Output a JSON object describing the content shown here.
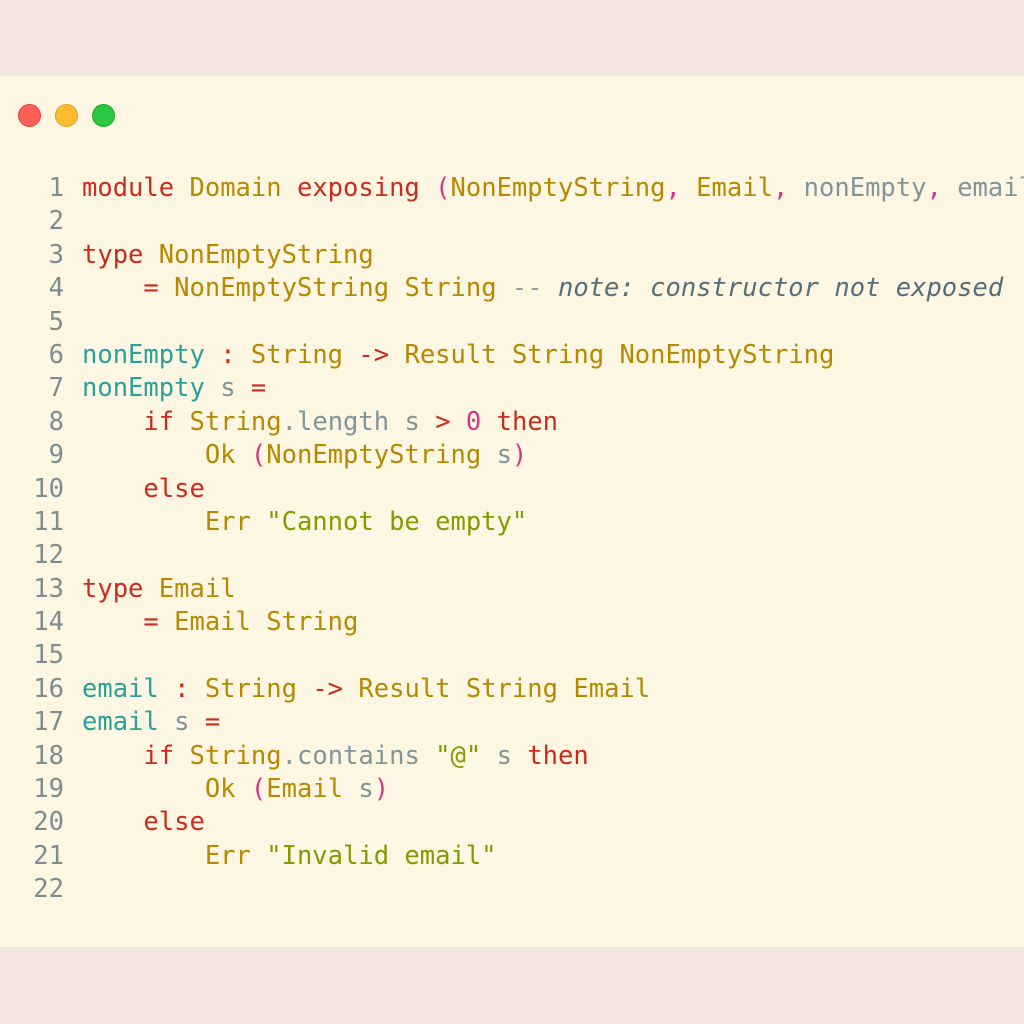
{
  "window": {
    "controls": [
      "close",
      "minimize",
      "zoom"
    ]
  },
  "editor": {
    "lines": [
      [
        [
          "kw",
          "module"
        ],
        [
          "plain",
          " "
        ],
        [
          "ty",
          "Domain"
        ],
        [
          "plain",
          " "
        ],
        [
          "kw",
          "exposing"
        ],
        [
          "plain",
          " "
        ],
        [
          "pn",
          "("
        ],
        [
          "ty",
          "NonEmptyString"
        ],
        [
          "pn",
          ","
        ],
        [
          "plain",
          " "
        ],
        [
          "ty",
          "Email"
        ],
        [
          "pn",
          ","
        ],
        [
          "plain",
          " "
        ],
        [
          "var",
          "nonEmpty"
        ],
        [
          "pn",
          ","
        ],
        [
          "plain",
          " "
        ],
        [
          "var",
          "email"
        ],
        [
          "pn",
          ")"
        ]
      ],
      [],
      [
        [
          "kw",
          "type"
        ],
        [
          "plain",
          " "
        ],
        [
          "ty",
          "NonEmptyString"
        ]
      ],
      [
        [
          "plain",
          "    "
        ],
        [
          "op",
          "="
        ],
        [
          "plain",
          " "
        ],
        [
          "ty",
          "NonEmptyString"
        ],
        [
          "plain",
          " "
        ],
        [
          "ty",
          "String"
        ],
        [
          "plain",
          " "
        ],
        [
          "cmd",
          "--"
        ],
        [
          "plain",
          " "
        ],
        [
          "cm",
          "note: constructor not exposed"
        ]
      ],
      [],
      [
        [
          "fn",
          "nonEmpty"
        ],
        [
          "plain",
          " "
        ],
        [
          "op",
          ":"
        ],
        [
          "plain",
          " "
        ],
        [
          "ty",
          "String"
        ],
        [
          "plain",
          " "
        ],
        [
          "op",
          "->"
        ],
        [
          "plain",
          " "
        ],
        [
          "ty",
          "Result"
        ],
        [
          "plain",
          " "
        ],
        [
          "ty",
          "String"
        ],
        [
          "plain",
          " "
        ],
        [
          "ty",
          "NonEmptyString"
        ]
      ],
      [
        [
          "fn",
          "nonEmpty"
        ],
        [
          "plain",
          " "
        ],
        [
          "var",
          "s"
        ],
        [
          "plain",
          " "
        ],
        [
          "op",
          "="
        ]
      ],
      [
        [
          "plain",
          "    "
        ],
        [
          "kw",
          "if"
        ],
        [
          "plain",
          " "
        ],
        [
          "ty",
          "String"
        ],
        [
          "var",
          "."
        ],
        [
          "var",
          "length"
        ],
        [
          "plain",
          " "
        ],
        [
          "var",
          "s"
        ],
        [
          "plain",
          " "
        ],
        [
          "op",
          ">"
        ],
        [
          "plain",
          " "
        ],
        [
          "num",
          "0"
        ],
        [
          "plain",
          " "
        ],
        [
          "kw",
          "then"
        ]
      ],
      [
        [
          "plain",
          "        "
        ],
        [
          "ty",
          "Ok"
        ],
        [
          "plain",
          " "
        ],
        [
          "pn",
          "("
        ],
        [
          "ty",
          "NonEmptyString"
        ],
        [
          "plain",
          " "
        ],
        [
          "var",
          "s"
        ],
        [
          "pn",
          ")"
        ]
      ],
      [
        [
          "plain",
          "    "
        ],
        [
          "kw",
          "else"
        ]
      ],
      [
        [
          "plain",
          "        "
        ],
        [
          "ty",
          "Err"
        ],
        [
          "plain",
          " "
        ],
        [
          "str",
          "\"Cannot be empty\""
        ]
      ],
      [],
      [
        [
          "kw",
          "type"
        ],
        [
          "plain",
          " "
        ],
        [
          "ty",
          "Email"
        ]
      ],
      [
        [
          "plain",
          "    "
        ],
        [
          "op",
          "="
        ],
        [
          "plain",
          " "
        ],
        [
          "ty",
          "Email"
        ],
        [
          "plain",
          " "
        ],
        [
          "ty",
          "String"
        ]
      ],
      [],
      [
        [
          "fn",
          "email"
        ],
        [
          "plain",
          " "
        ],
        [
          "op",
          ":"
        ],
        [
          "plain",
          " "
        ],
        [
          "ty",
          "String"
        ],
        [
          "plain",
          " "
        ],
        [
          "op",
          "->"
        ],
        [
          "plain",
          " "
        ],
        [
          "ty",
          "Result"
        ],
        [
          "plain",
          " "
        ],
        [
          "ty",
          "String"
        ],
        [
          "plain",
          " "
        ],
        [
          "ty",
          "Email"
        ]
      ],
      [
        [
          "fn",
          "email"
        ],
        [
          "plain",
          " "
        ],
        [
          "var",
          "s"
        ],
        [
          "plain",
          " "
        ],
        [
          "op",
          "="
        ]
      ],
      [
        [
          "plain",
          "    "
        ],
        [
          "kw",
          "if"
        ],
        [
          "plain",
          " "
        ],
        [
          "ty",
          "String"
        ],
        [
          "var",
          "."
        ],
        [
          "var",
          "contains"
        ],
        [
          "plain",
          " "
        ],
        [
          "str",
          "\"@\""
        ],
        [
          "plain",
          " "
        ],
        [
          "var",
          "s"
        ],
        [
          "plain",
          " "
        ],
        [
          "kw",
          "then"
        ]
      ],
      [
        [
          "plain",
          "        "
        ],
        [
          "ty",
          "Ok"
        ],
        [
          "plain",
          " "
        ],
        [
          "pn",
          "("
        ],
        [
          "ty",
          "Email"
        ],
        [
          "plain",
          " "
        ],
        [
          "var",
          "s"
        ],
        [
          "pn",
          ")"
        ]
      ],
      [
        [
          "plain",
          "    "
        ],
        [
          "kw",
          "else"
        ]
      ],
      [
        [
          "plain",
          "        "
        ],
        [
          "ty",
          "Err"
        ],
        [
          "plain",
          " "
        ],
        [
          "str",
          "\"Invalid email\""
        ]
      ],
      []
    ]
  }
}
